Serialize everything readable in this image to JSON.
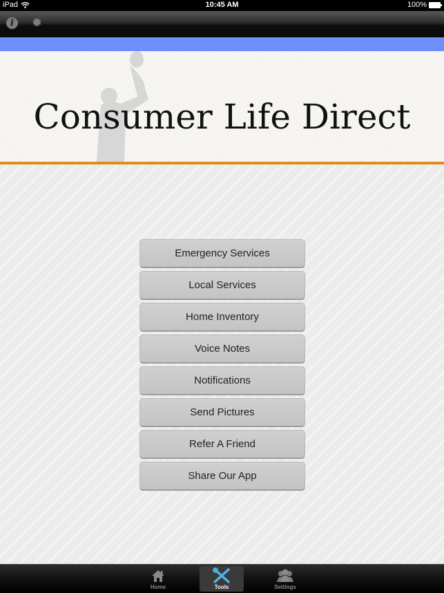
{
  "status_bar": {
    "device": "iPad",
    "time": "10:45 AM",
    "battery": "100%"
  },
  "toolbar": {
    "icons": [
      "info-icon",
      "gear-icon"
    ]
  },
  "banner": {
    "title": "Consumer Life Direct"
  },
  "menu": {
    "items": [
      {
        "label": "Emergency Services"
      },
      {
        "label": "Local Services"
      },
      {
        "label": "Home Inventory"
      },
      {
        "label": "Voice Notes"
      },
      {
        "label": "Notifications"
      },
      {
        "label": "Send Pictures"
      },
      {
        "label": "Refer A Friend"
      },
      {
        "label": "Share Our App"
      }
    ]
  },
  "tabbar": {
    "tabs": [
      {
        "label": "Home",
        "icon": "home-icon",
        "active": false
      },
      {
        "label": "Tools",
        "icon": "tools-icon",
        "active": true
      },
      {
        "label": "Settings",
        "icon": "users-icon",
        "active": false
      }
    ]
  },
  "colors": {
    "accent_blue": "#6d8ffc",
    "accent_orange": "#e38a1f",
    "tools_icon_blue": "#4fb3e8"
  }
}
